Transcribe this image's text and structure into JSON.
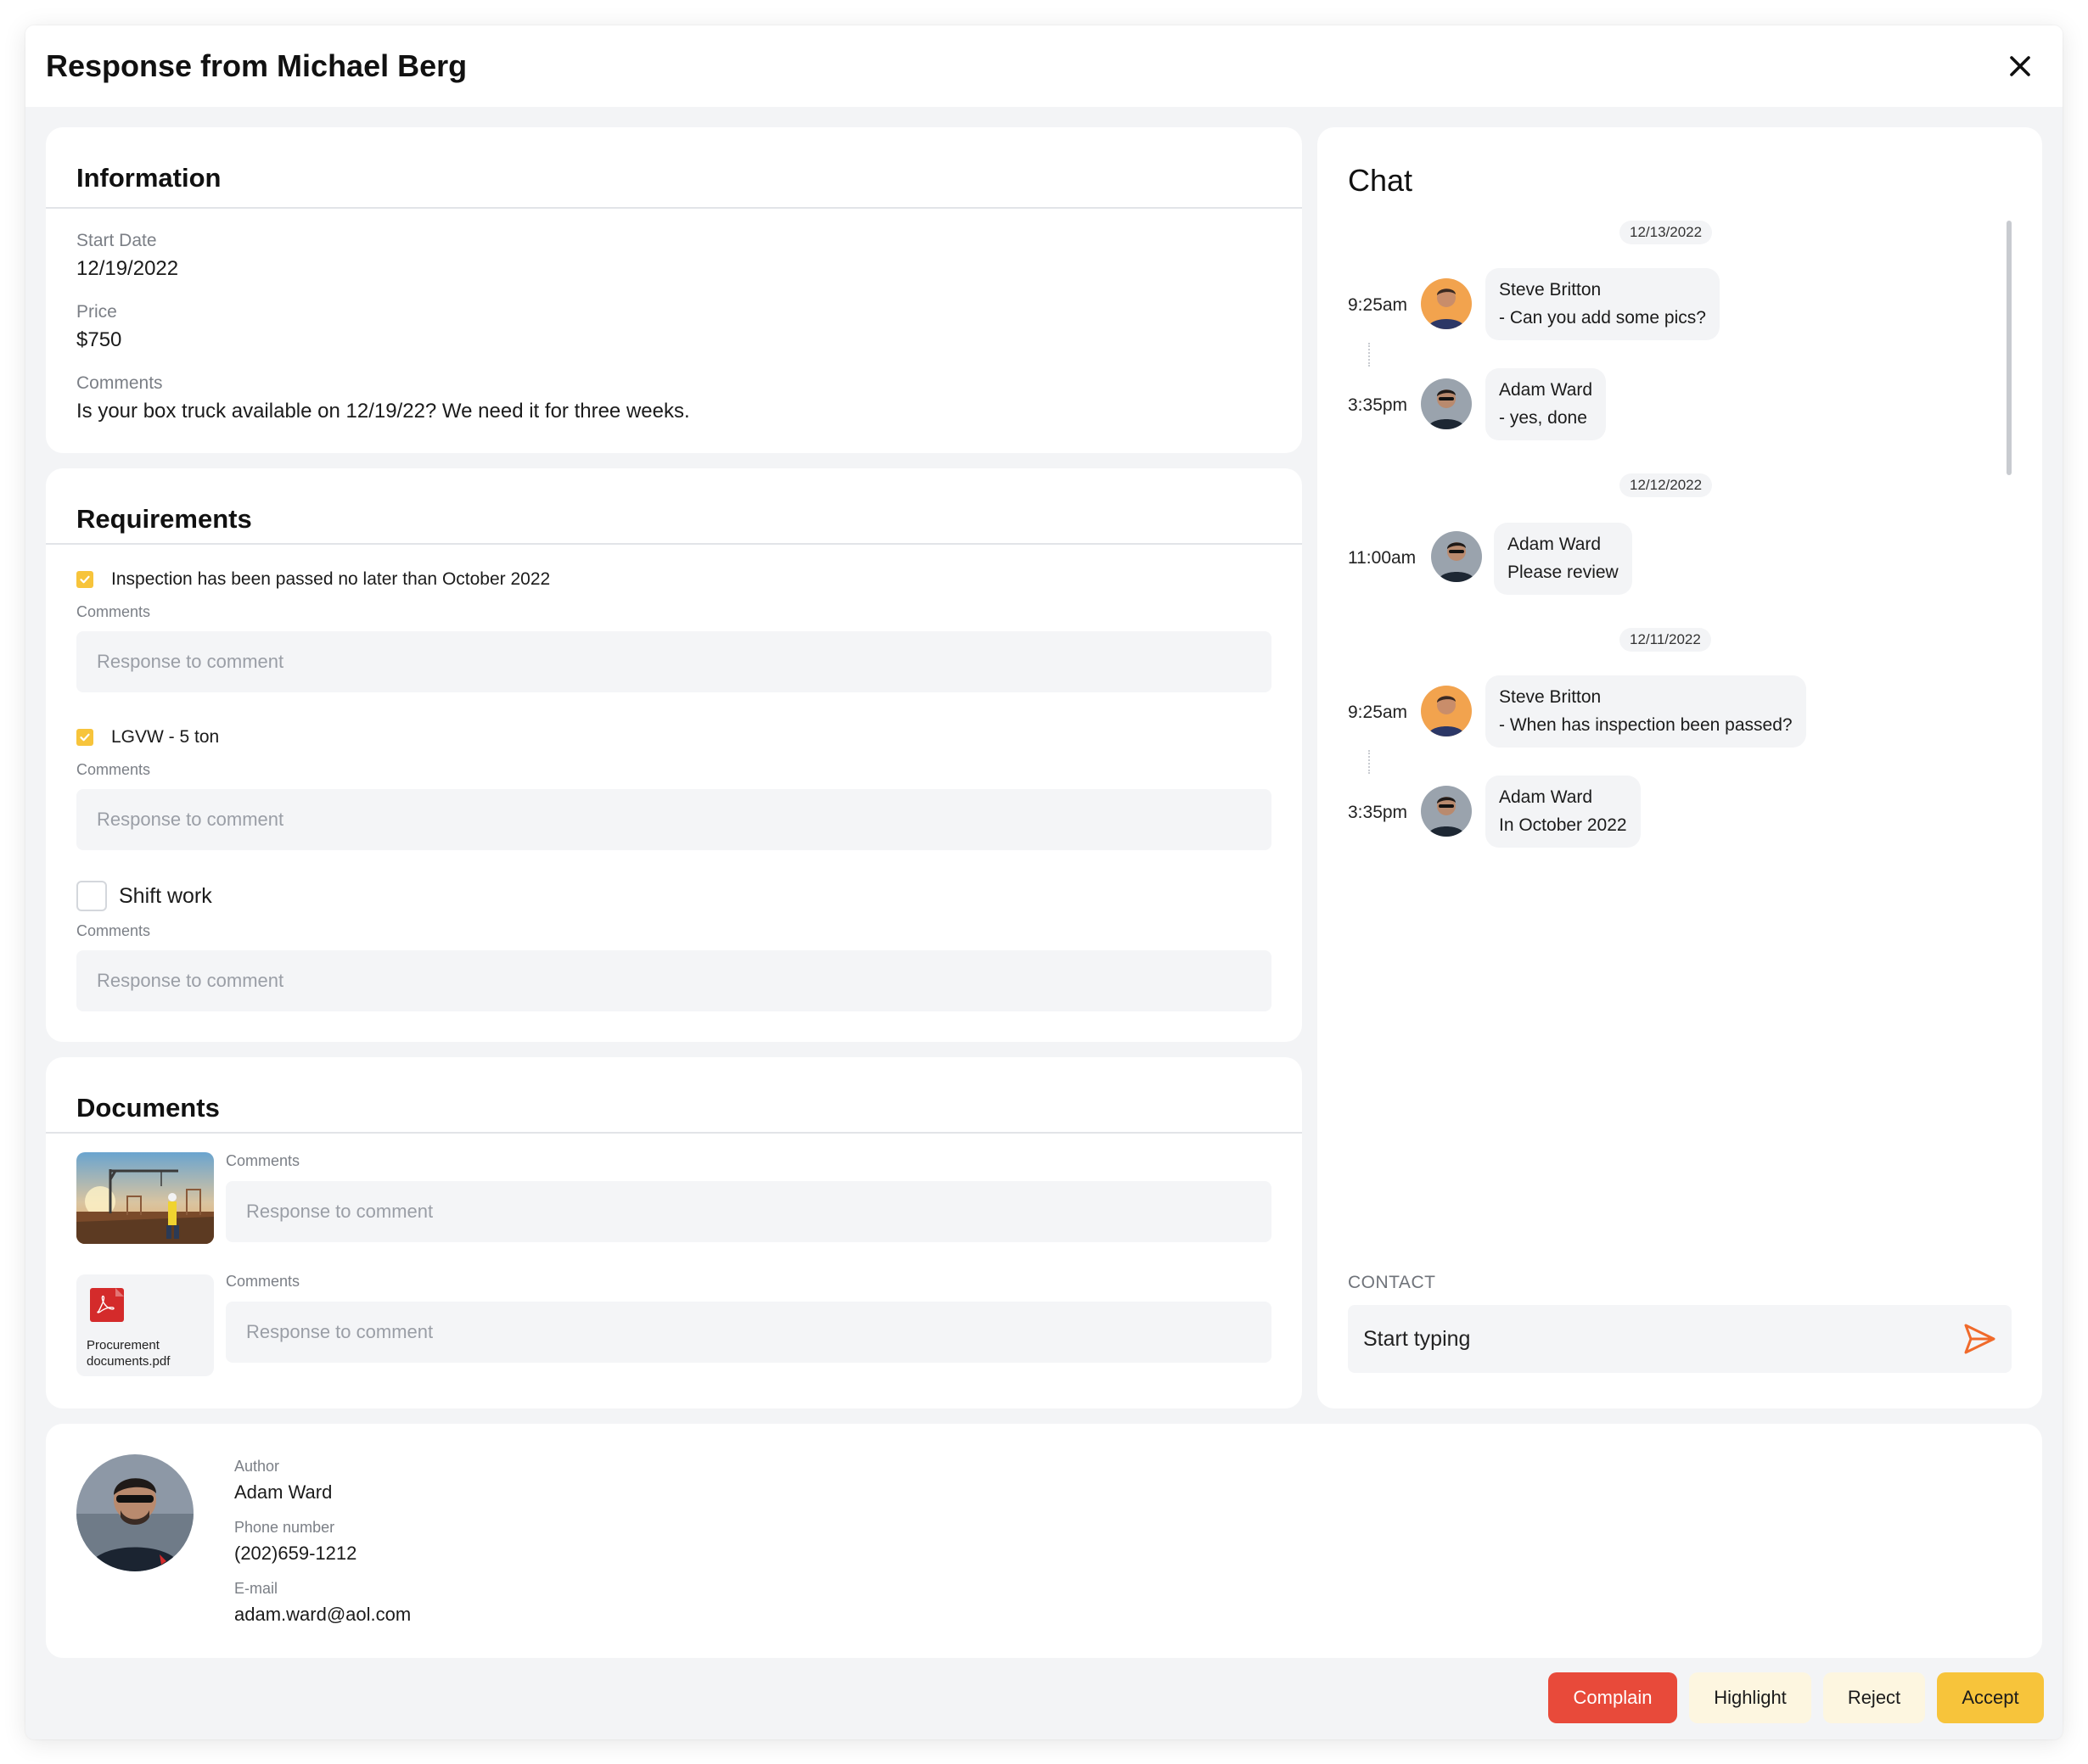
{
  "header": {
    "title": "Response from Michael Berg"
  },
  "information": {
    "title": "Information",
    "start_date_label": "Start Date",
    "start_date": "12/19/2022",
    "price_label": "Price",
    "price": "$750",
    "comments_label": "Comments",
    "comments": "Is your box truck available on 12/19/22? We need it for three weeks."
  },
  "requirements": {
    "title": "Requirements",
    "items": [
      {
        "label": "Inspection has been passed no later than October 2022",
        "checked": true,
        "comments_label": "Comments",
        "placeholder": "Response to comment"
      },
      {
        "label": "LGVW - 5 ton",
        "checked": true,
        "comments_label": "Comments",
        "placeholder": "Response to comment"
      },
      {
        "label": "Shift work",
        "checked": false,
        "comments_label": "Comments",
        "placeholder": "Response to comment"
      }
    ]
  },
  "documents": {
    "title": "Documents",
    "items": [
      {
        "type": "image",
        "comments_label": "Comments",
        "placeholder": "Response to comment"
      },
      {
        "type": "pdf",
        "file_name": "Procurement documents.pdf",
        "comments_label": "Comments",
        "placeholder": "Response to comment"
      }
    ]
  },
  "chat": {
    "title": "Chat",
    "dates": [
      "12/13/2022",
      "12/12/2022",
      "12/11/2022"
    ],
    "messages": [
      {
        "time": "9:25am",
        "author": "Steve Britton",
        "text": "- Can you add some pics?"
      },
      {
        "time": "3:35pm",
        "author": "Adam Ward",
        "text": "- yes, done"
      },
      {
        "time": "11:00am",
        "author": "Adam Ward",
        "text": "Please review"
      },
      {
        "time": "9:25am",
        "author": "Steve Britton",
        "text": "- When has inspection been passed?"
      },
      {
        "time": "3:35pm",
        "author": "Adam Ward",
        "text": "In October 2022"
      }
    ],
    "contact_label": "CONTACT",
    "input_placeholder": "Start typing"
  },
  "author": {
    "author_label": "Author",
    "author_name": "Adam Ward",
    "phone_label": "Phone number",
    "phone": "(202)659-1212",
    "email_label": "E-mail",
    "email": "adam.ward@aol.com"
  },
  "actions": {
    "complain": "Complain",
    "highlight": "Highlight",
    "reject": "Reject",
    "accept": "Accept"
  },
  "colors": {
    "accent": "#f7c43b",
    "danger": "#e84a3a",
    "soft": "#fdf6e0",
    "send_icon": "#f06a2b"
  }
}
